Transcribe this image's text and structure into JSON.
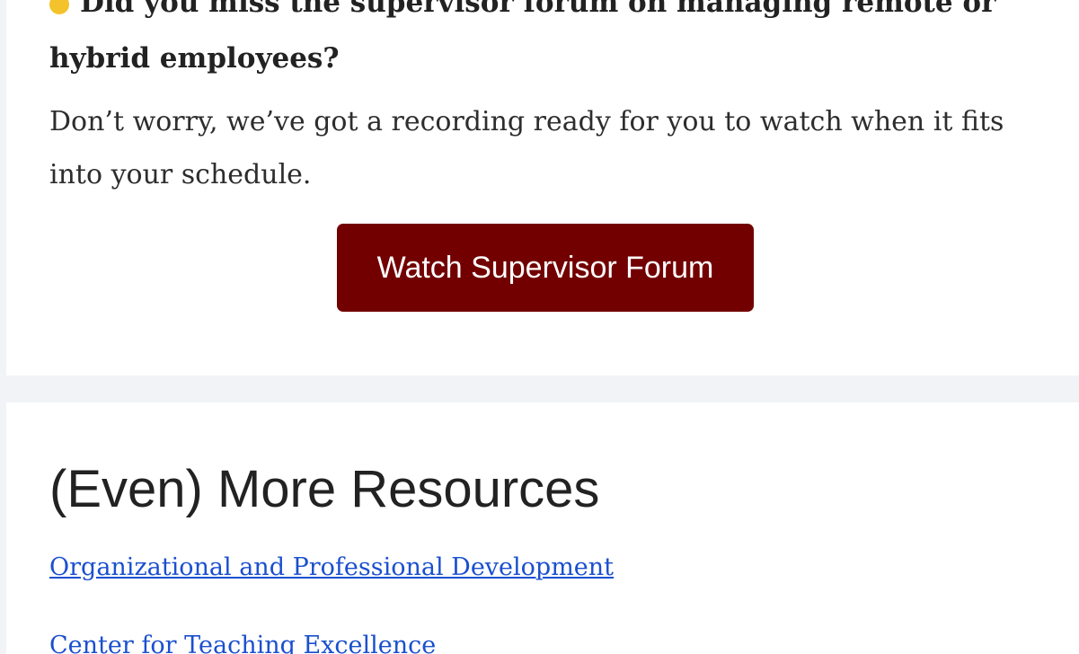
{
  "forum": {
    "heading_partial": "Did you miss the supervisor forum on managing remote or hybrid employees?",
    "body": "Don’t worry, we’ve got a recording ready for you to watch when it fits into your schedule.",
    "button_label": "Watch Supervisor Forum"
  },
  "resources": {
    "title": "(Even) More Resources",
    "links": [
      "Organizational and Professional Development",
      "Center for Teaching Excellence"
    ]
  },
  "colors": {
    "button_bg": "#720000",
    "link": "#1a4fcf",
    "page_bg": "#f2f3f7"
  }
}
